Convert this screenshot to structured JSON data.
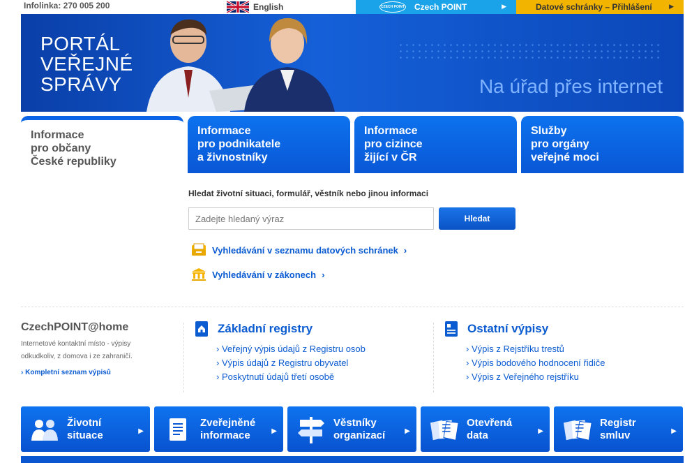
{
  "topbar": {
    "infolinka": "Infolinka: 270 005 200",
    "english": "English",
    "czechpoint_logo": "CZECH POINT",
    "czechpoint": "Czech POINT",
    "datove": "Datové schránky – Přihlášení"
  },
  "banner": {
    "title_lines": [
      "PORTÁL",
      "VEŘEJNÉ",
      "SPRÁVY"
    ],
    "slogan": "Na úřad přes internet"
  },
  "tabs": [
    {
      "lines": [
        "Informace",
        "pro občany",
        "České republiky"
      ]
    },
    {
      "lines": [
        "Informace",
        "pro podnikatele",
        "a živnostníky"
      ]
    },
    {
      "lines": [
        "Informace",
        "pro cizince",
        "žijící v ČR"
      ]
    },
    {
      "lines": [
        "Služby",
        "pro orgány",
        "veřejné moci"
      ]
    }
  ],
  "search": {
    "label": "Hledat životní situaci, formulář, věstník nebo jinou informaci",
    "placeholder": "Zadejte hledaný výraz",
    "button": "Hledat"
  },
  "quick_links": [
    {
      "label": "Vyhledávání v seznamu datových schránek",
      "icon": "inbox-icon"
    },
    {
      "label": "Vyhledávání v zákonech",
      "icon": "courthouse-icon"
    }
  ],
  "czechpoint_home": {
    "title": "CzechPOINT@home",
    "description": "Internetové kontaktní místo - výpisy odkudkoliv, z domova i ze zahraničí.",
    "link": "Kompletní seznam výpisů"
  },
  "zakladni_registry": {
    "title": "Základní registry",
    "items": [
      "Veřejný výpis údajů z Registru osob",
      "Výpis údajů z Registru obyvatel",
      "Poskytnutí údajů třetí osobě"
    ]
  },
  "ostatni_vypisy": {
    "title": "Ostatní výpisy",
    "items": [
      "Výpis z Rejstříku trestů",
      "Výpis bodového hodnocení řidiče",
      "Výpis z Veřejného rejstříku"
    ]
  },
  "bottom_buttons": [
    {
      "lines": [
        "Životní",
        "situace"
      ],
      "icon": "people-icon"
    },
    {
      "lines": [
        "Zveřejněné",
        "informace"
      ],
      "icon": "document-icon"
    },
    {
      "lines": [
        "Věstníky",
        "organizací"
      ],
      "icon": "signpost-icon"
    },
    {
      "lines": [
        "Otevřená",
        "data"
      ],
      "icon": "documents-icon"
    },
    {
      "lines": [
        "Registr",
        "smluv"
      ],
      "icon": "contracts-icon"
    }
  ],
  "colors": {
    "brand_blue": "#0b5bd1",
    "czechpoint_cyan": "#1aa3e8",
    "datove_yellow": "#f3b400"
  }
}
